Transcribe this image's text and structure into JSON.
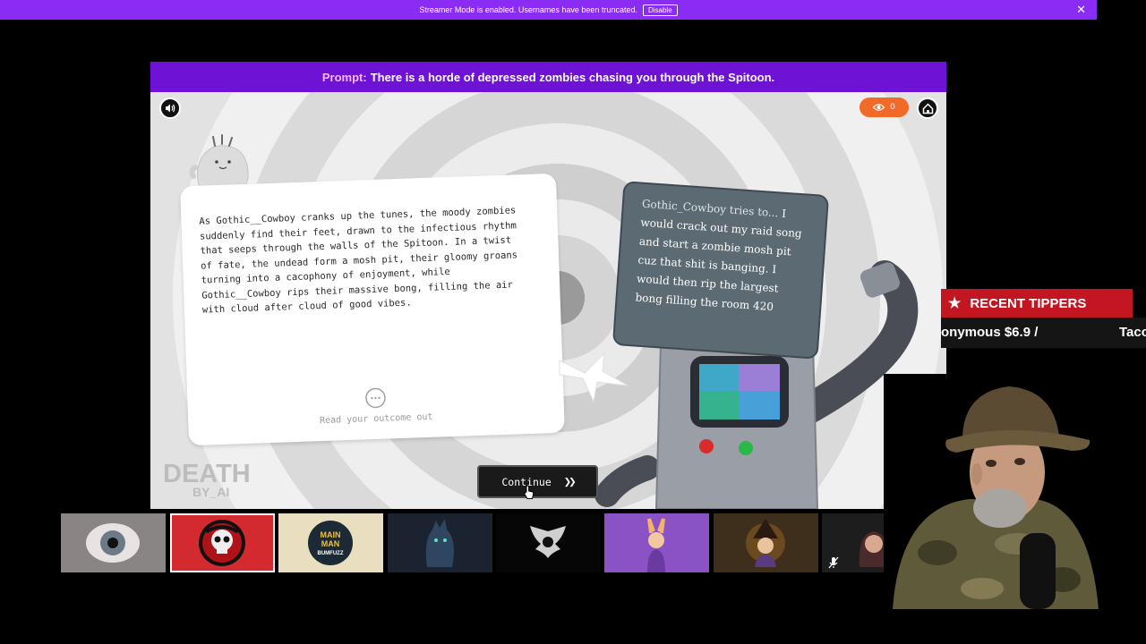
{
  "banner": {
    "message": "Streamer Mode is enabled. Usernames have been truncated.",
    "disable_label": "Disable",
    "close_glyph": "✕",
    "color": "#8b2cf5"
  },
  "game": {
    "prompt_label": "Prompt:",
    "prompt_text": "There is a horde of depressed zombies chasing you through the Spitoon.",
    "viewer_count": "0",
    "outcome_text": "As Gothic__Cowboy cranks up the tunes, the moody zombies suddenly find their feet, drawn to the infectious rhythm that seeps through the walls of the Spitoon. In a twist of fate, the undead form a mosh pit, their gloomy groans turning into a cacophony of enjoyment, while Gothic__Cowboy rips their massive bong, filling the air with cloud after cloud of good vibes.",
    "read_outcome_label": "Read your outcome out",
    "action_who": "Gothic_Cowboy tries to...",
    "action_text": "I would crack out my raid song and start a zombie mosh pit cuz that shit is banging. I would then rip the largest bong filling the room 420",
    "continue_label": "Continue",
    "continue_glyph": "❯❯",
    "logo_line1": "DEATH",
    "logo_line2": "BY_AI",
    "icons": [
      "speaker-icon",
      "eye-icon",
      "home-icon",
      "chat-bubble-icon",
      "double-chevron-right-icon"
    ],
    "accent_color": "#6e12d6",
    "prompt_label_color": "#f7b7ff"
  },
  "tippers": {
    "title": "RECENT TIPPERS",
    "star": "★",
    "ticker_1": "onymous $6.9 /",
    "ticker_2": "Taco"
  },
  "player_thumbnails": [
    {
      "name": "eye avatar"
    },
    {
      "name": "red skull avatar"
    },
    {
      "name": "Main Man Bumfuzz avatar"
    },
    {
      "name": "dark creature avatar"
    },
    {
      "name": "black wings avatar"
    },
    {
      "name": "purple bunny avatar"
    },
    {
      "name": "witch avatar"
    },
    {
      "name": "woman avatar",
      "mute_icon": "mic-muted-icon"
    }
  ],
  "thumbnail_texts": {
    "main_man": "MAIN",
    "man": "MAN",
    "bumfuzz": "BUMFUZZ"
  }
}
